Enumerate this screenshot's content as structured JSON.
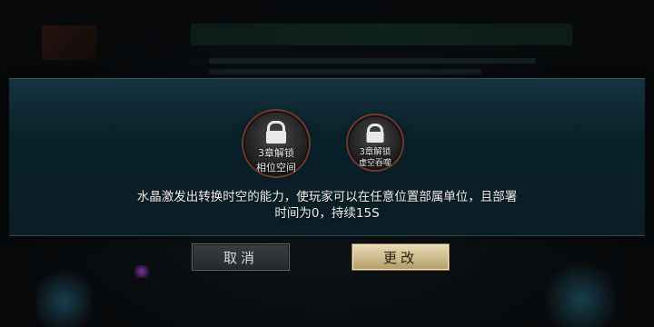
{
  "background": {
    "banner_text": "",
    "accent_glow": "#3ca0c8"
  },
  "dialog": {
    "skills": [
      {
        "line1": "3章解锁",
        "line2": "相位空间",
        "icon": "lock-icon"
      },
      {
        "line1": "3章解锁",
        "line2": "虚空吞噬",
        "icon": "lock-icon"
      }
    ],
    "description_line1": "水晶激发出转换时空的能力，使玩家可以在任意位置部属单位，且部署",
    "description_line2": "时间为0，持续15S",
    "cancel_label": "取消",
    "change_label": "更改"
  }
}
